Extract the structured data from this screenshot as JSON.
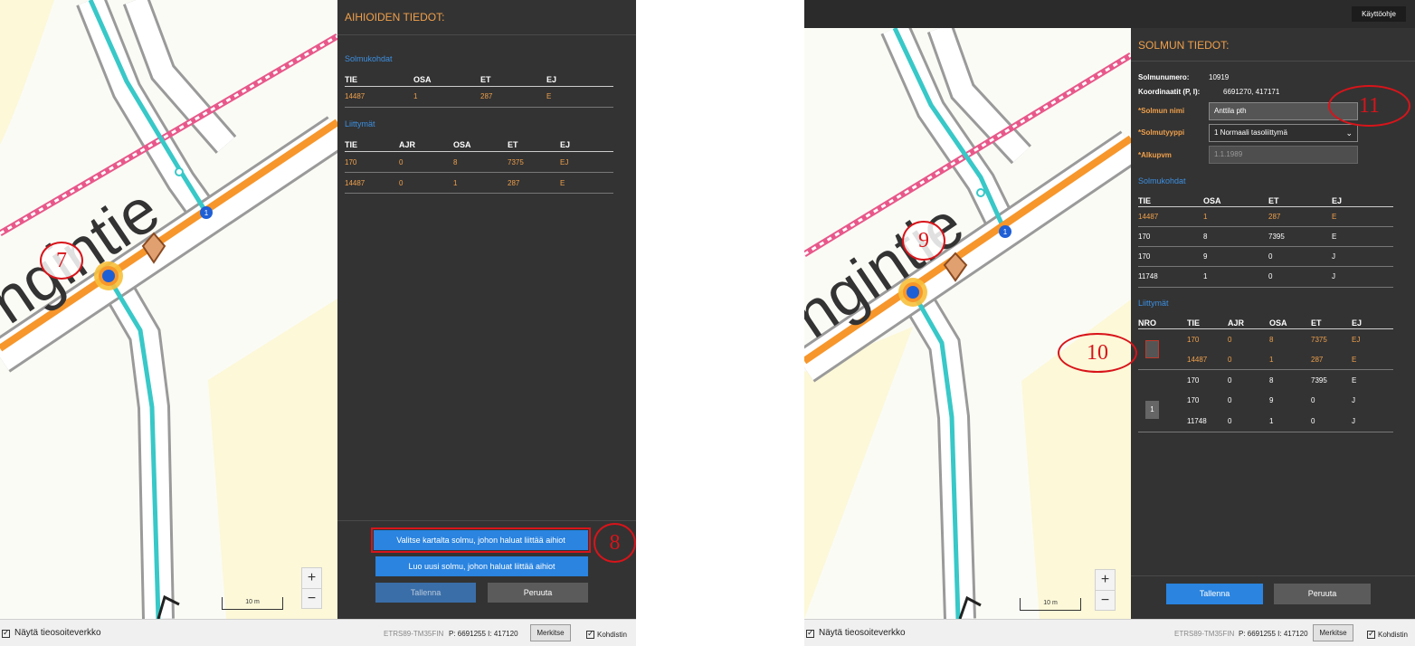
{
  "left": {
    "panel_title": "AIHIOIDEN TIEDOT:",
    "solmukohdat": {
      "title": "Solmukohdat",
      "headers": [
        "TIE",
        "OSA",
        "ET",
        "EJ"
      ],
      "rows": [
        [
          "14487",
          "1",
          "287",
          "E"
        ]
      ]
    },
    "liittymat": {
      "title": "Liittymät",
      "headers": [
        "TIE",
        "AJR",
        "OSA",
        "ET",
        "EJ"
      ],
      "rows": [
        [
          "170",
          "0",
          "8",
          "7375",
          "EJ"
        ],
        [
          "14487",
          "0",
          "1",
          "287",
          "E"
        ]
      ]
    },
    "buttons": {
      "select_node": "Valitse kartalta solmu, johon haluat liittää aihiot",
      "new_node": "Luo uusi solmu, johon haluat liittää aihiot",
      "save": "Tallenna",
      "cancel": "Peruuta"
    },
    "map": {
      "marker_number": "1",
      "scale_label": "10 m",
      "zoom_in": "+",
      "zoom_out": "−",
      "street_label": "ngintie"
    },
    "callouts": {
      "a": "7",
      "b": "8"
    },
    "bottom": {
      "show_network": "Näytä tieosoiteverkko",
      "crs": "ETRS89-TM35FIN",
      "coords": "P: 6691255  I: 417120",
      "mark": "Merkitse",
      "cursor": "Kohdistin"
    }
  },
  "right": {
    "top_help": "Käyttöohje",
    "panel_title": "SOLMUN TIEDOT:",
    "info": {
      "node_number_label": "Solmunumero:",
      "node_number": "10919",
      "coords_label": "Koordinaatit (P, I):",
      "coords": "6691270, 417171",
      "name_label": "*Solmun nimi",
      "name_value": "Anttila pth",
      "type_label": "*Solmutyyppi",
      "type_value": "1 Normaali tasoliittymä",
      "start_label": "*Alkupvm",
      "start_value": "1.1.1989"
    },
    "solmukohdat": {
      "title": "Solmukohdat",
      "headers": [
        "TIE",
        "OSA",
        "ET",
        "EJ"
      ],
      "rows": [
        {
          "cells": [
            "14487",
            "1",
            "287",
            "E"
          ],
          "highlight": true
        },
        {
          "cells": [
            "170",
            "8",
            "7395",
            "E"
          ],
          "highlight": false
        },
        {
          "cells": [
            "170",
            "9",
            "0",
            "J"
          ],
          "highlight": false
        },
        {
          "cells": [
            "11748",
            "1",
            "0",
            "J"
          ],
          "highlight": false
        }
      ]
    },
    "liittymat": {
      "title": "Liittymät",
      "headers": [
        "NRO",
        "TIE",
        "AJR",
        "OSA",
        "ET",
        "EJ"
      ],
      "nro_box_2": "1",
      "rows": [
        {
          "cells": [
            "170",
            "0",
            "8",
            "7375",
            "EJ"
          ],
          "highlight": true
        },
        {
          "cells": [
            "14487",
            "0",
            "1",
            "287",
            "E"
          ],
          "highlight": true
        },
        {
          "cells": [
            "170",
            "0",
            "8",
            "7395",
            "E"
          ],
          "highlight": false
        },
        {
          "cells": [
            "170",
            "0",
            "9",
            "0",
            "J"
          ],
          "highlight": false
        },
        {
          "cells": [
            "11748",
            "0",
            "1",
            "0",
            "J"
          ],
          "highlight": false
        }
      ]
    },
    "buttons": {
      "save": "Tallenna",
      "cancel": "Peruuta"
    },
    "map": {
      "marker_number": "1",
      "scale_label": "10 m",
      "zoom_in": "+",
      "zoom_out": "−",
      "street_label": "ngintie"
    },
    "callouts": {
      "a": "9",
      "b": "10",
      "c": "11"
    },
    "bottom": {
      "show_network": "Näytä tieosoiteverkko",
      "crs": "ETRS89-TM35FIN",
      "coords": "P: 6691255  I: 417120",
      "mark": "Merkitse",
      "cursor": "Kohdistin"
    }
  },
  "colors": {
    "panel_bg": "#333333",
    "title_orange": "#f0a04b",
    "section_blue": "#3c8fe0",
    "button_blue": "#2a84e0",
    "road_orange": "#f7962b",
    "road_cyan": "#38c8c8",
    "rail_pink": "#e8588a",
    "callout_red": "#d8141a"
  }
}
